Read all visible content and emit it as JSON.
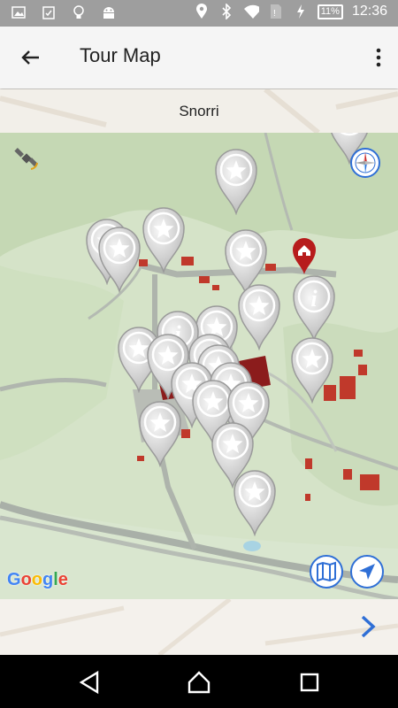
{
  "status_bar": {
    "battery": "11%",
    "time": "12:36"
  },
  "app_bar": {
    "title": "Tour Map"
  },
  "location_label": "Snorri",
  "map": {
    "attribution": "Google",
    "accent_color": "#2f6fd6",
    "pin_color": "#c0c0c0",
    "info_pin_color": "#b71c1c"
  },
  "icons": {
    "back": "arrow-left-icon",
    "overflow": "more-vertical-icon",
    "gps": "satellite-icon",
    "compass": "compass-icon",
    "map_layers": "map-icon",
    "my_location": "navigation-arrow-icon",
    "next": "chevron-right-icon"
  }
}
